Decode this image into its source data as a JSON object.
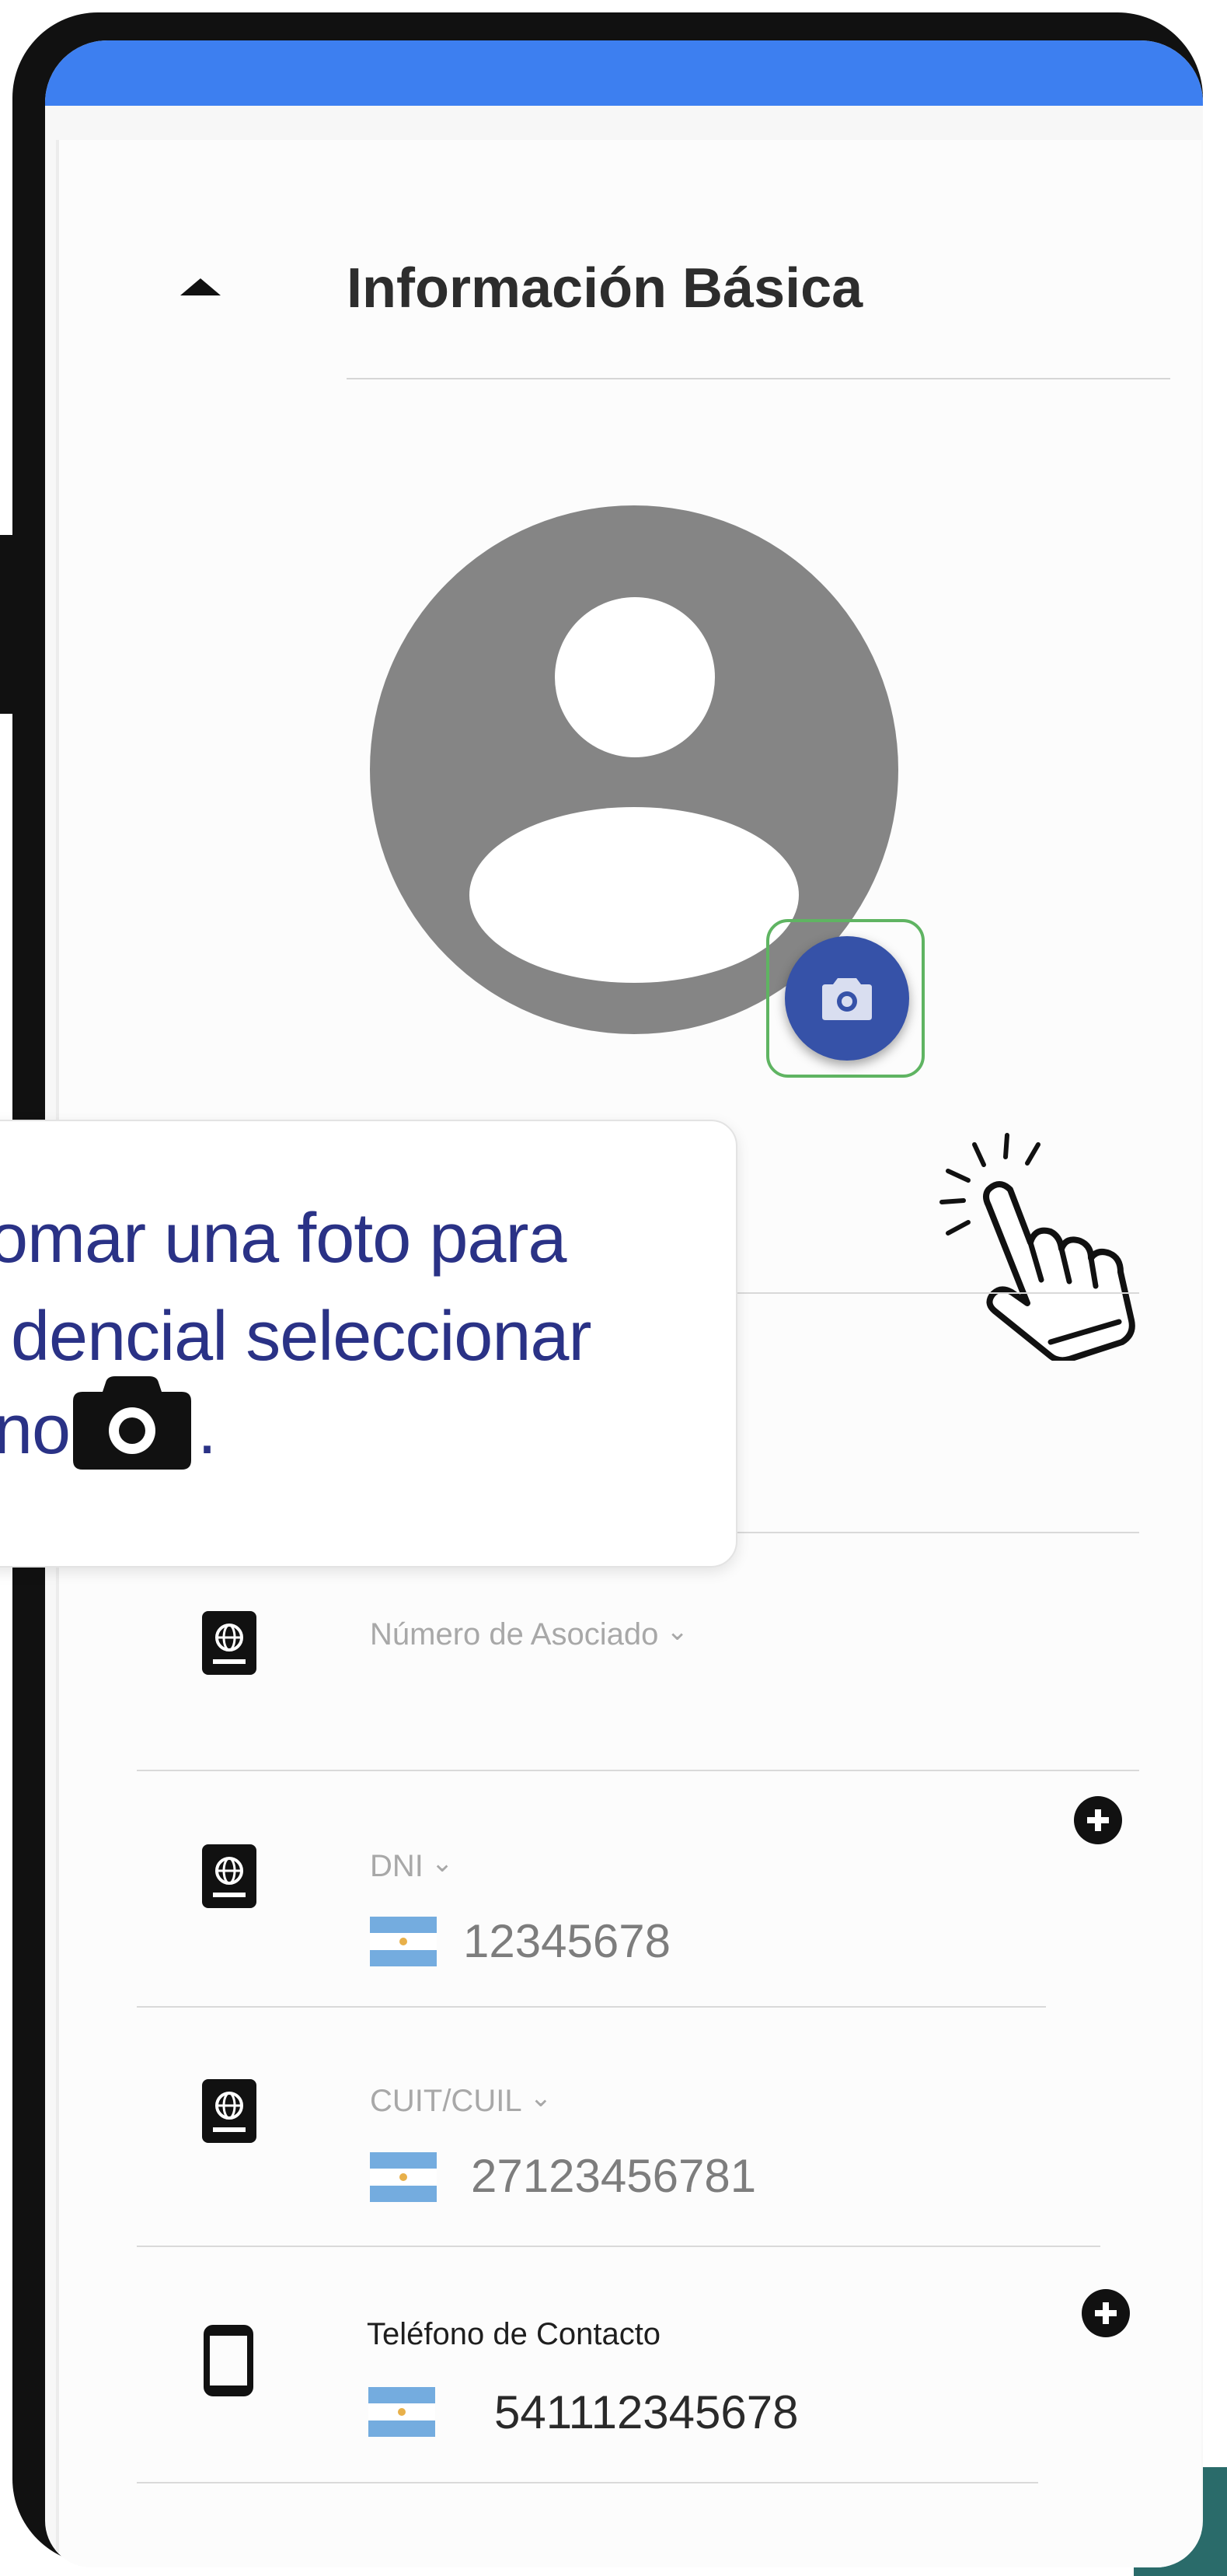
{
  "section": {
    "title": "Información Básica"
  },
  "avatar": {
    "camera_icon": "camera-icon"
  },
  "tooltip": {
    "line1": "tomar una foto para",
    "line2": "dencial seleccionar",
    "line3_prefix": "no",
    "line3_suffix": "."
  },
  "fields": {
    "associate": {
      "label": "Número de Asociado",
      "icon": "passport-icon"
    },
    "dni": {
      "label": "DNI",
      "value": "12345678",
      "icon": "passport-icon"
    },
    "cuit": {
      "label": "CUIT/CUIL",
      "value": "27123456781",
      "icon": "passport-icon"
    },
    "phone": {
      "label": "Teléfono de Contacto",
      "value": "541112345678",
      "icon": "phone-icon"
    }
  },
  "colors": {
    "top_bar": "#3d7ff0",
    "camera_button": "#3652a8",
    "highlight": "#5fb462",
    "tooltip_text": "#2a3286",
    "flag_blue": "#74acdf"
  }
}
